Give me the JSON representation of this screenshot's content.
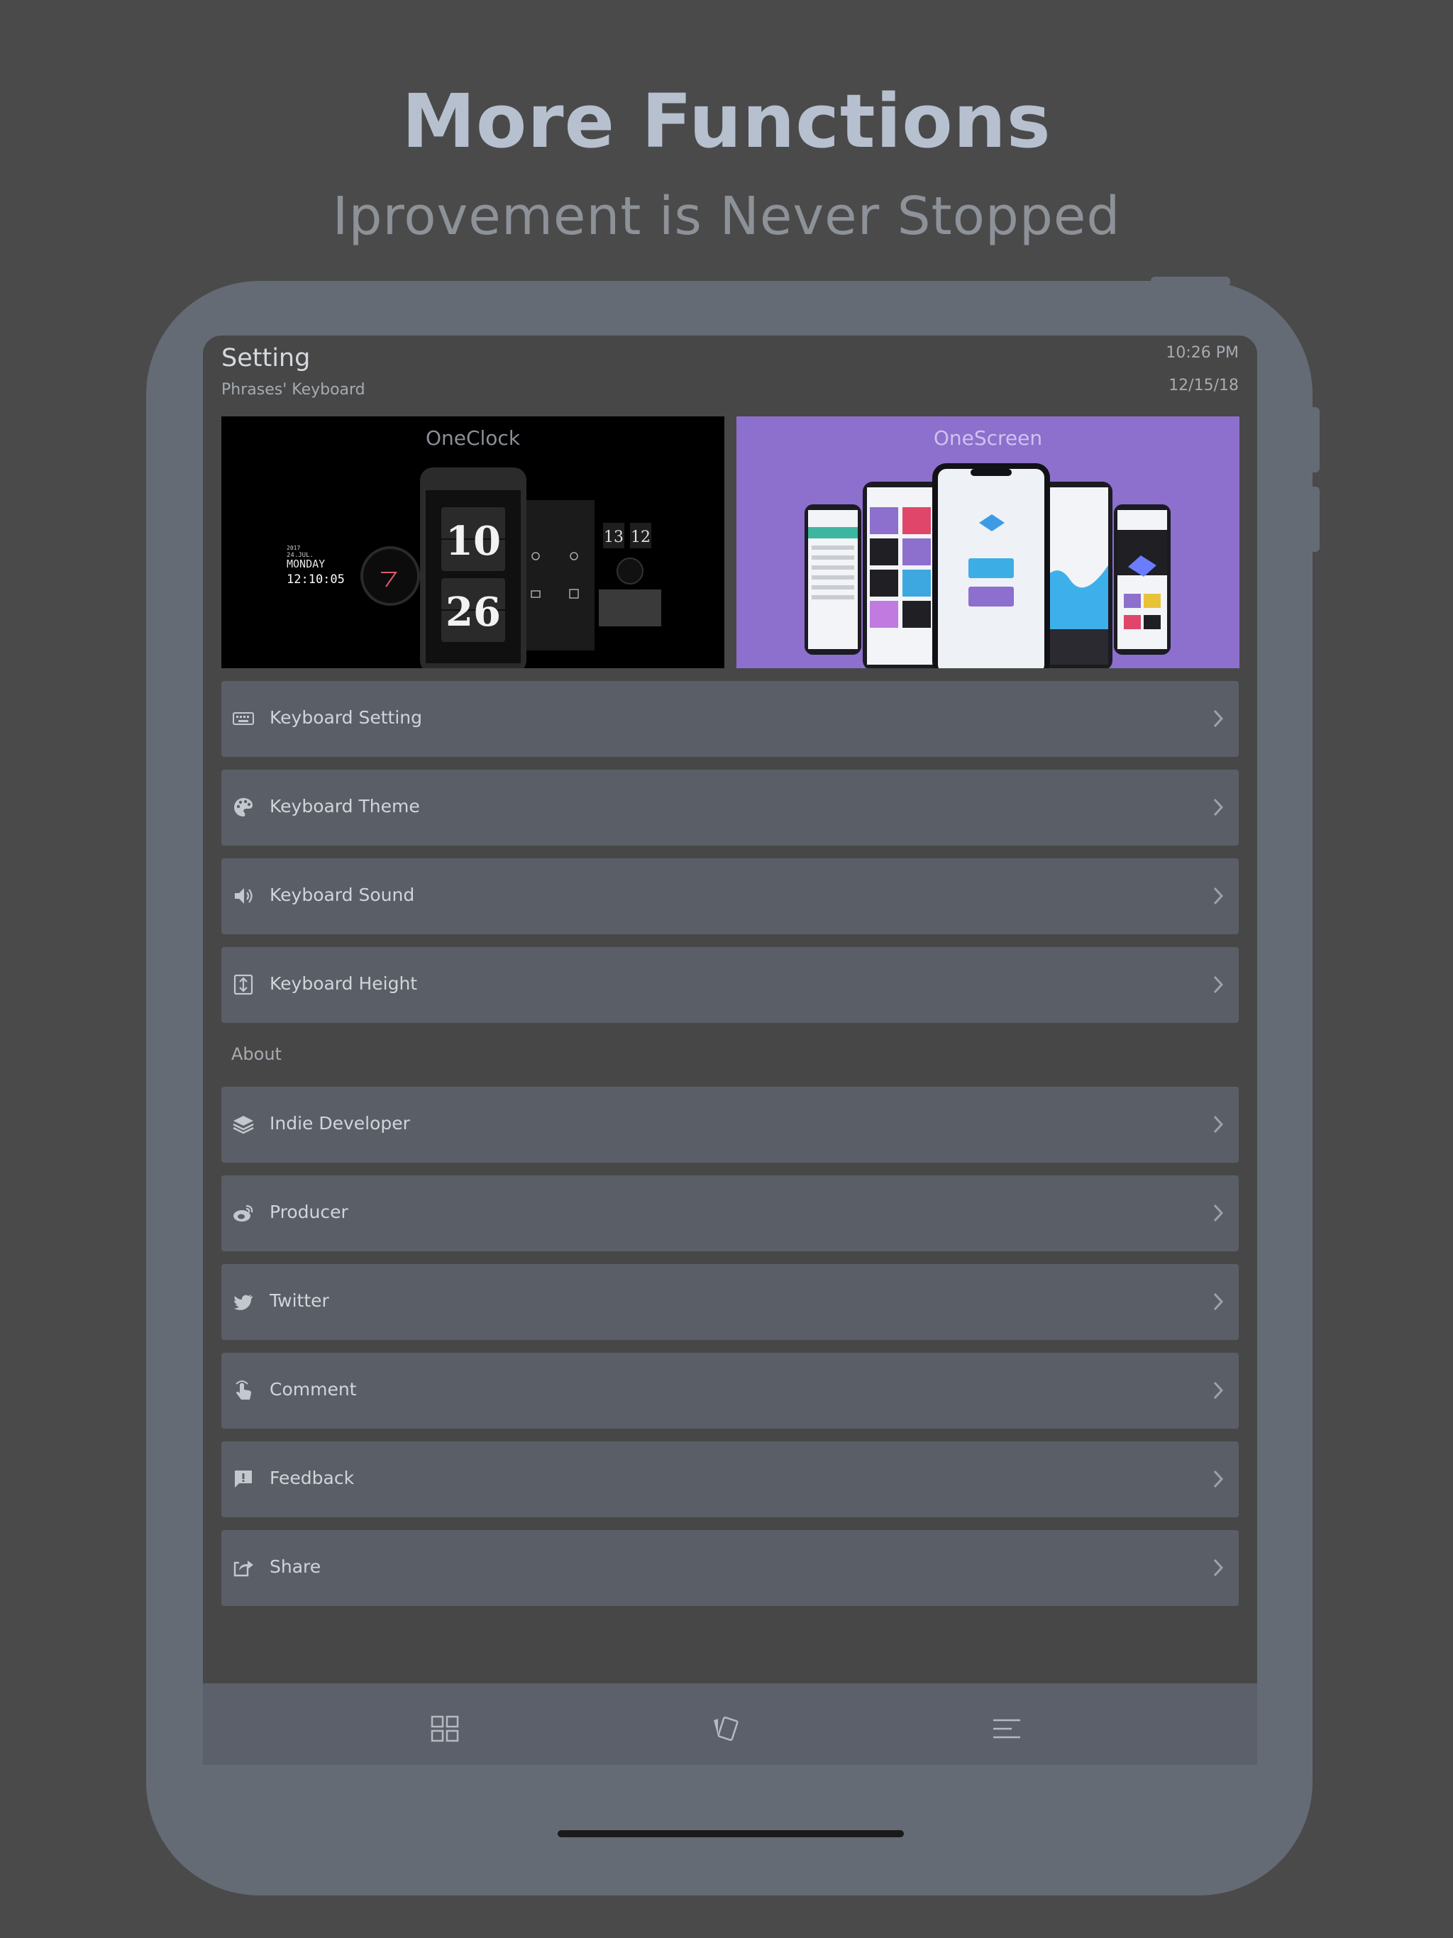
{
  "hero": {
    "title": "More Functions",
    "subtitle": "Iprovement is Never Stopped"
  },
  "header": {
    "title": "Setting",
    "subtitle": "Phrases' Keyboard",
    "time": "10:26 PM",
    "date": "12/15/18"
  },
  "promos": [
    {
      "label": "OneClock",
      "clock_digits": [
        "10",
        "26"
      ],
      "small_digits": [
        "13",
        "12"
      ],
      "clock_text": [
        "2017",
        "24.JUL.",
        "MONDAY",
        "12:10:05"
      ]
    },
    {
      "label": "OneScreen"
    }
  ],
  "settings": [
    {
      "label": "Keyboard Setting",
      "icon": "keyboard-icon"
    },
    {
      "label": "Keyboard Theme",
      "icon": "palette-icon"
    },
    {
      "label": "Keyboard Sound",
      "icon": "speaker-icon"
    },
    {
      "label": "Keyboard Height",
      "icon": "height-icon"
    }
  ],
  "about": {
    "heading": "About",
    "items": [
      {
        "label": "Indie Developer",
        "icon": "layers-icon"
      },
      {
        "label": "Producer",
        "icon": "weibo-icon"
      },
      {
        "label": "Twitter",
        "icon": "twitter-icon"
      },
      {
        "label": "Comment",
        "icon": "tap-icon"
      },
      {
        "label": "Feedback",
        "icon": "feedback-icon"
      },
      {
        "label": "Share",
        "icon": "share-icon"
      }
    ]
  },
  "tabs": [
    {
      "name": "grid-icon"
    },
    {
      "name": "cards-icon"
    },
    {
      "name": "menu-icon"
    }
  ],
  "colors": {
    "background": "#4a4a4a",
    "device": "#646b75",
    "row": "#5a5f67",
    "accent_purple": "#8d6fcd"
  }
}
